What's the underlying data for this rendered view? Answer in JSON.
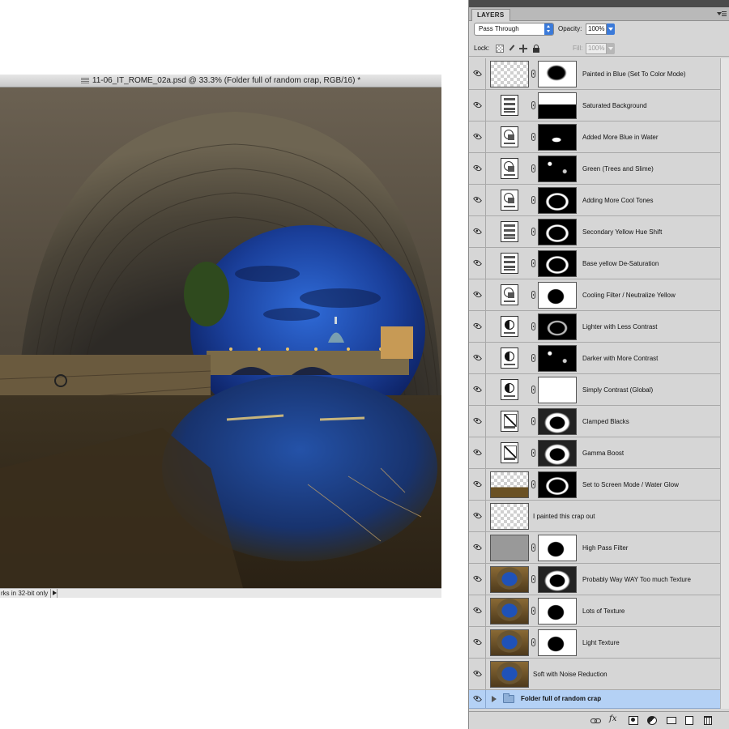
{
  "document": {
    "title": "11-06_IT_ROME_02a.psd @ 33.3% (Folder full of random crap, RGB/16) *",
    "status": "rks in 32-bit only"
  },
  "panel": {
    "tab": "LAYERS",
    "blend_mode": "Pass Through",
    "opacity_label": "Opacity:",
    "opacity_value": "100%",
    "lock_label": "Lock:",
    "fill_label": "Fill:",
    "fill_value": "100%"
  },
  "layers": [
    {
      "name": "Painted in Blue (Set To Color Mode)",
      "visible": true,
      "thumb": "transparent",
      "mask": "blob"
    },
    {
      "name": "Saturated Background",
      "visible": true,
      "thumb": "hue-saturation",
      "mask": "hbar"
    },
    {
      "name": "Added More Blue in Water",
      "visible": true,
      "thumb": "photo-filter",
      "mask": "spot"
    },
    {
      "name": "Green (Trees and Slime)",
      "visible": true,
      "thumb": "photo-filter",
      "mask": "speck"
    },
    {
      "name": "Adding More Cool Tones",
      "visible": true,
      "thumb": "photo-filter",
      "mask": "ring"
    },
    {
      "name": "Secondary Yellow Hue Shift",
      "visible": true,
      "thumb": "hue-saturation",
      "mask": "ring"
    },
    {
      "name": "Base yellow De-Saturation",
      "visible": true,
      "thumb": "hue-saturation",
      "mask": "ring"
    },
    {
      "name": "Cooling Filter / Neutralize Yellow",
      "visible": true,
      "thumb": "photo-filter",
      "mask": "blackblob"
    },
    {
      "name": "Lighter with Less Contrast",
      "visible": true,
      "thumb": "brightness-contrast",
      "mask": "dark"
    },
    {
      "name": "Darker with More Contrast",
      "visible": true,
      "thumb": "brightness-contrast",
      "mask": "speck"
    },
    {
      "name": "Simply Contrast (Global)",
      "visible": true,
      "thumb": "brightness-contrast",
      "mask": "white"
    },
    {
      "name": "Clamped Blacks",
      "visible": true,
      "thumb": "curves",
      "mask": "ringw"
    },
    {
      "name": "Gamma Boost",
      "visible": true,
      "thumb": "curves",
      "mask": "ringw"
    },
    {
      "name": "Set to Screen Mode / Water Glow",
      "visible": true,
      "thumb": "photo-water",
      "mask": "ring"
    },
    {
      "name": "I painted this crap out",
      "visible": true,
      "thumb": "transparent",
      "mask": ""
    },
    {
      "name": "High Pass Filter",
      "visible": true,
      "thumb": "gray",
      "mask": "blackblob"
    },
    {
      "name": "Probably Way WAY Too much Texture",
      "visible": true,
      "thumb": "photo",
      "mask": "ringw"
    },
    {
      "name": "Lots of Texture",
      "visible": true,
      "thumb": "photo",
      "mask": "blackblob"
    },
    {
      "name": "Light Texture",
      "visible": true,
      "thumb": "photo",
      "mask": "blackblob"
    },
    {
      "name": "Soft with Noise Reduction",
      "visible": true,
      "thumb": "photo",
      "mask": ""
    }
  ],
  "folder": {
    "name": "Folder full of random crap",
    "visible": true,
    "selected": true
  },
  "toolbar": {
    "buttons": [
      "link-layers",
      "fx",
      "add-mask",
      "new-adjustment",
      "new-group",
      "new-layer",
      "delete"
    ],
    "fx_label": "fx"
  },
  "colors": {
    "panel_bg": "#d6d6d6",
    "selected_row": "#b4d1f5",
    "accent_blue": "#3b7ad9"
  }
}
